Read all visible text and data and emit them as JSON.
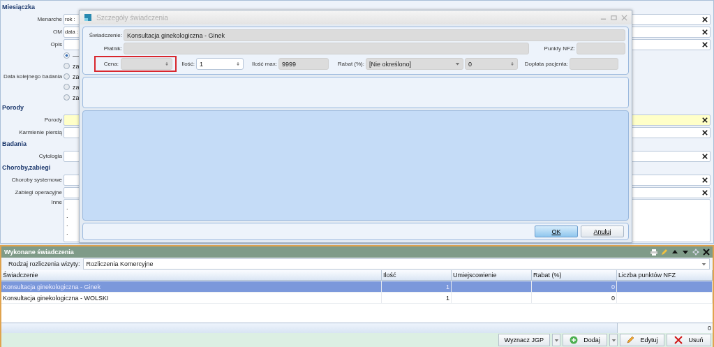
{
  "form": {
    "sections": [
      {
        "title": "Miesiączka",
        "rows": [
          {
            "kind": "field",
            "label": "Menarche",
            "value": "rok :",
            "clearable": true,
            "highlighted": false
          },
          {
            "kind": "field",
            "label": "OM",
            "value": "data :",
            "clearable": true,
            "highlighted": false
          },
          {
            "kind": "field",
            "label": "Opis",
            "clearable": true,
            "highlighted": false
          },
          {
            "kind": "radios",
            "label": "Data kolejnego badania",
            "options": [
              {
                "label": "—",
                "selected": true
              },
              {
                "label": "za",
                "selected": false
              },
              {
                "label": "za",
                "selected": false
              },
              {
                "label": "za",
                "selected": false
              },
              {
                "label": "za",
                "selected": false
              }
            ]
          }
        ]
      },
      {
        "title": "Porody",
        "rows": [
          {
            "kind": "field",
            "label": "Porody",
            "clearable": true,
            "highlighted": true
          },
          {
            "kind": "field",
            "label": "Karmienie piersią",
            "clearable": true,
            "highlighted": false
          }
        ]
      },
      {
        "title": "Badania",
        "rows": [
          {
            "kind": "field",
            "label": "Cytologia",
            "clearable": true,
            "highlighted": false
          }
        ]
      },
      {
        "title": "Choroby,zabiegi",
        "rows": [
          {
            "kind": "field",
            "label": "Choroby systemowe",
            "clearable": true,
            "highlighted": false
          },
          {
            "kind": "field",
            "label": "Zabiegi operacyjne",
            "clearable": true,
            "highlighted": false
          },
          {
            "kind": "textarea",
            "label": "Inne",
            "lines": [
              ".",
              ".",
              ".",
              "."
            ]
          }
        ]
      }
    ]
  },
  "dialog": {
    "title": "Szczegóły świadczenia",
    "active": false,
    "service": {
      "label": "Świadczenie:",
      "value": "Konsultacja ginekologiczna - Ginek"
    },
    "payer": {
      "label": "Płatnik:"
    },
    "nfz_points": {
      "label": "Punkty NFZ:"
    },
    "price": {
      "label": "Cena:",
      "highlighted": true
    },
    "quantity": {
      "label": "Ilość:",
      "value": "1"
    },
    "max_quantity": {
      "label": "Ilość max:",
      "value": "9999"
    },
    "discount": {
      "label": "Rabat (%):",
      "value": "[Nie określono]",
      "amount": "0"
    },
    "copay": {
      "label": "Dopłata pacjenta:"
    },
    "buttons": [
      {
        "label": "OK",
        "default": true
      },
      {
        "label": "Anuluj",
        "default": false
      }
    ]
  },
  "panel": {
    "title": "Wykonane świadczenia",
    "settlement": {
      "label": "Rodzaj rozliczenia wizyty:",
      "value": "Rozliczenia Komercyjne"
    },
    "table": {
      "columns": [
        "Świadczenie",
        "Ilość",
        "Umiejscowienie",
        "Rabat (%)",
        "Liczba punktów NFZ"
      ],
      "rows": [
        {
          "cells": [
            "Konsultacja ginekologiczna - Ginek",
            "1",
            "",
            "0",
            ""
          ],
          "selected": true
        },
        {
          "cells": [
            "Konsultacja ginekologiczna - WOLSKI",
            "1",
            "",
            "0",
            ""
          ],
          "selected": false
        }
      ],
      "footer_total": "0"
    },
    "buttons": [
      {
        "label": "Wyznacz JGP",
        "kind": "split"
      },
      {
        "label": "Dodaj",
        "kind": "add"
      },
      {
        "label": "Edytuj",
        "kind": "edit"
      },
      {
        "label": "Usuń",
        "kind": "delete"
      }
    ]
  }
}
